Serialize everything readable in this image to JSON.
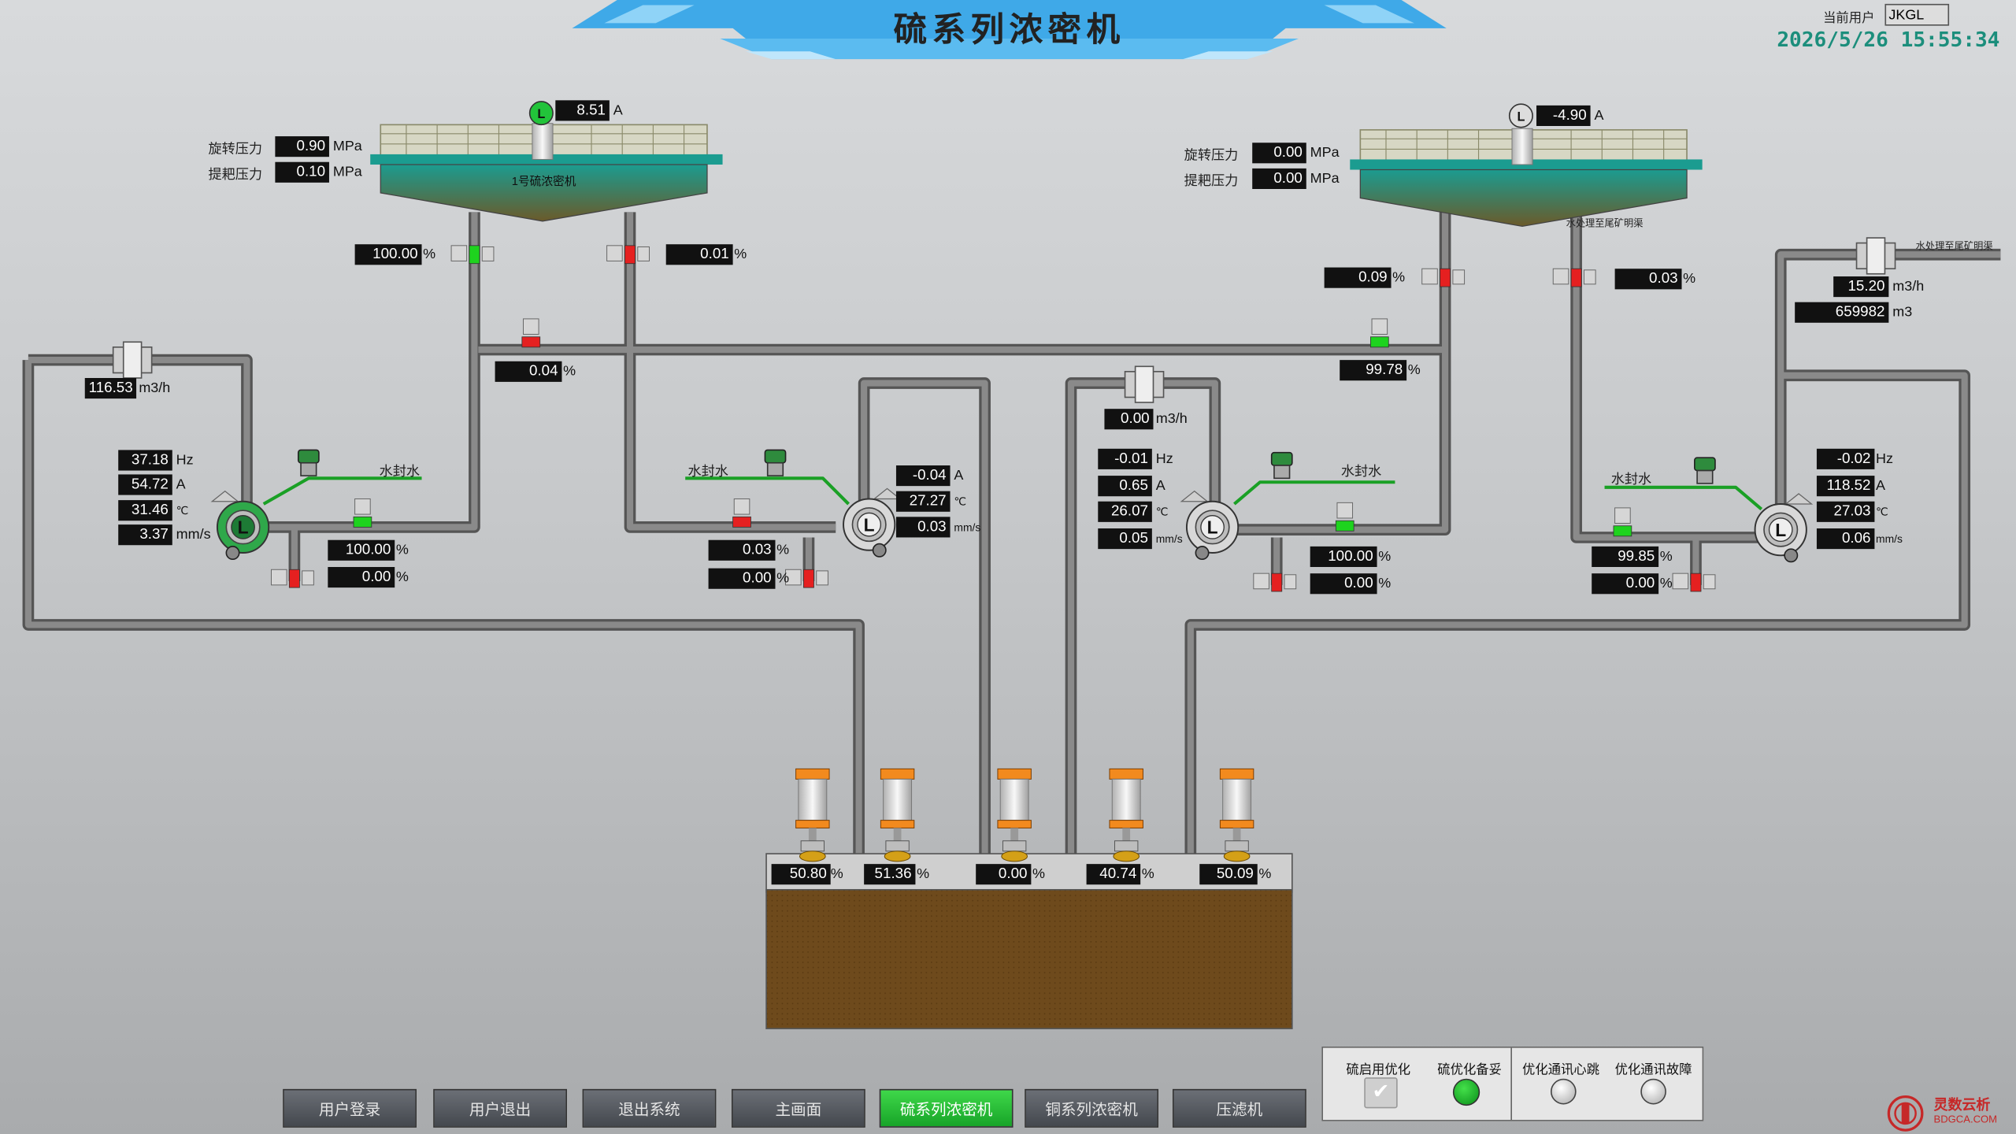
{
  "header": {
    "title": "硫系列浓密机",
    "current_user_label": "当前用户",
    "current_user": "JKGL",
    "datetime": "2026/5/26 15:55:34"
  },
  "thickener1": {
    "name": "1号硫浓密机",
    "rotate_label": "旋转压力",
    "rotate_value": "0.90",
    "lift_label": "提耙压力",
    "lift_value": "0.10",
    "pressure_unit": "MPa",
    "current": "8.51",
    "current_unit": "A",
    "motor_icon": "L",
    "motor_color": "#22c33a"
  },
  "thickener2": {
    "overflow_label": "水处理至尾矿明渠",
    "rotate_label": "旋转压力",
    "rotate_value": "0.00",
    "lift_label": "提耙压力",
    "lift_value": "0.00",
    "pressure_unit": "MPa",
    "current": "-4.90",
    "current_unit": "A",
    "motor_icon": "L",
    "motor_color": "#dddddd"
  },
  "valves": {
    "t1_left_out": "100.00",
    "t1_right_out": "0.01",
    "header_left": "0.04",
    "t2_left_out": "0.09",
    "t2_right_out": "0.03",
    "header_right": "99.78",
    "pump1_out": "100.00",
    "pump1_drain": "0.00",
    "pump2_out": "0.03",
    "pump2_drain": "0.00",
    "pump3_out": "100.00",
    "pump3_drain": "0.00",
    "pump4_out": "99.85",
    "pump4_drain": "0.00",
    "percent_unit": "%"
  },
  "flows": {
    "left_flow": "116.53",
    "center_flow": "0.00",
    "right_flow": "15.20",
    "right_total": "659982",
    "flow_unit": "m3/h",
    "total_unit": "m3",
    "right_label": "水处理至尾矿明渠"
  },
  "water_seal_label": "水封水",
  "pumps": [
    {
      "icon": "L",
      "color": "#2fa84a",
      "hz": "37.18",
      "amp": "54.72",
      "temp": "31.46",
      "vib": "3.37"
    },
    {
      "icon": "L",
      "color": "#d8d8d8",
      "hz": "",
      "amp": "-0.04",
      "temp": "27.27",
      "vib": "0.03"
    },
    {
      "icon": "L",
      "color": "#d8d8d8",
      "hz": "-0.01",
      "amp": "0.65",
      "temp": "26.07",
      "vib": "0.05"
    },
    {
      "icon": "L",
      "color": "#d8d8d8",
      "hz": "-0.02",
      "amp": "118.52",
      "temp": "27.03",
      "vib": "0.06"
    }
  ],
  "units": {
    "hz": "Hz",
    "amp": "A",
    "temp": "℃",
    "vib": "mm/s"
  },
  "feed_valves": [
    "50.80",
    "51.36",
    "0.00",
    "40.74",
    "50.09"
  ],
  "nav": [
    "用户登录",
    "用户退出",
    "退出系统",
    "主画面",
    "硫系列浓密机",
    "铜系列浓密机",
    "压滤机"
  ],
  "nav_active_index": 4,
  "optimization": {
    "enable_label": "硫启用优化",
    "standby_label": "硫优化备妥",
    "heartbeat_label": "优化通讯心跳",
    "fault_label": "优化通讯故障",
    "enable_checked": true,
    "standby_on": true,
    "heartbeat_on": false,
    "fault_on": false
  },
  "brand": {
    "name": "灵数云析",
    "url": "BDGCA.COM"
  },
  "colors": {
    "valve_open": "#1ed31e",
    "valve_closed": "#e52020",
    "pipe": "#6e6e6e",
    "header_accent": "#3fa9e8"
  }
}
